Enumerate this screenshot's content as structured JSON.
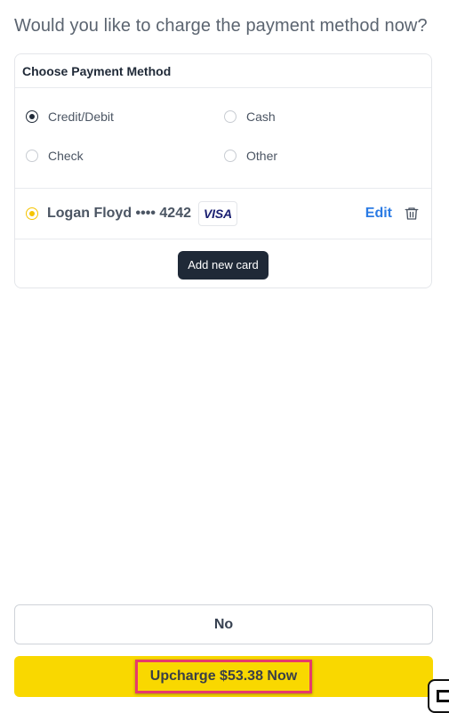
{
  "question": "Would you like to charge the payment method now?",
  "payment_card": {
    "header": "Choose Payment Method",
    "options": [
      {
        "label": "Credit/Debit",
        "selected": true
      },
      {
        "label": "Cash",
        "selected": false
      },
      {
        "label": "Check",
        "selected": false
      },
      {
        "label": "Other",
        "selected": false
      }
    ],
    "saved_card": {
      "holder": "Logan Floyd •••• 4242",
      "brand": "VISA",
      "edit_label": "Edit",
      "selected": true
    },
    "add_new_card_label": "Add new card"
  },
  "actions": {
    "no_label": "No",
    "upcharge_label": "Upcharge $53.38 Now"
  },
  "colors": {
    "accent_yellow": "#f9d800",
    "link_blue": "#2b7be4",
    "dark": "#1f2937",
    "highlight_pink": "#e73a6b"
  },
  "icons": {
    "trash": "trash-icon",
    "corner": "app-widget-icon"
  }
}
